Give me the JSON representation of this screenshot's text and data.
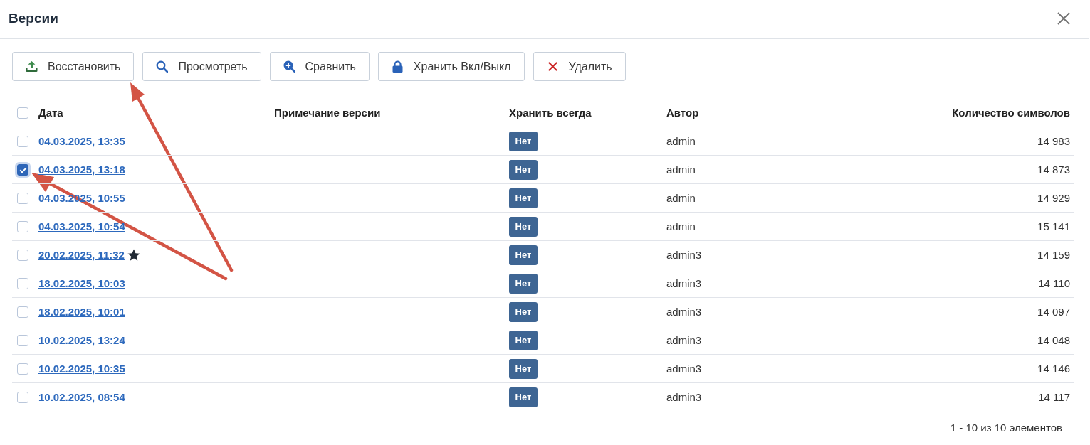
{
  "window": {
    "title": "Версии"
  },
  "toolbar": {
    "buttons": [
      {
        "label": "Восстановить",
        "kind": "restore"
      },
      {
        "label": "Просмотреть",
        "kind": "view"
      },
      {
        "label": "Сравнить",
        "kind": "compare"
      },
      {
        "label": "Хранить Вкл/Выкл",
        "kind": "keep"
      },
      {
        "label": "Удалить",
        "kind": "delete"
      }
    ]
  },
  "table": {
    "header_checkbox": {
      "checked": false
    },
    "columns": [
      {
        "label": "Дата"
      },
      {
        "label": "Примечание версии"
      },
      {
        "label": "Хранить всегда"
      },
      {
        "label": "Автор"
      },
      {
        "label": "Количество символов"
      }
    ],
    "rows": [
      {
        "checked": false,
        "date": "04.03.2025, 13:35",
        "starred": false,
        "keep_always": "Нет",
        "author": "admin",
        "characters": "14 983"
      },
      {
        "checked": true,
        "date": "04.03.2025, 13:18",
        "starred": false,
        "keep_always": "Нет",
        "author": "admin",
        "characters": "14 873"
      },
      {
        "checked": false,
        "date": "04.03.2025, 10:55",
        "starred": false,
        "keep_always": "Нет",
        "author": "admin",
        "characters": "14 929"
      },
      {
        "checked": false,
        "date": "04.03.2025, 10:54",
        "starred": false,
        "keep_always": "Нет",
        "author": "admin",
        "characters": "15 141"
      },
      {
        "checked": false,
        "date": "20.02.2025, 11:32",
        "starred": true,
        "keep_always": "Нет",
        "author": "admin3",
        "characters": "14 159"
      },
      {
        "checked": false,
        "date": "18.02.2025, 10:03",
        "starred": false,
        "keep_always": "Нет",
        "author": "admin3",
        "characters": "14 110"
      },
      {
        "checked": false,
        "date": "18.02.2025, 10:01",
        "starred": false,
        "keep_always": "Нет",
        "author": "admin3",
        "characters": "14 097"
      },
      {
        "checked": false,
        "date": "10.02.2025, 13:24",
        "starred": false,
        "keep_always": "Нет",
        "author": "admin3",
        "characters": "14 048"
      },
      {
        "checked": false,
        "date": "10.02.2025, 10:35",
        "starred": false,
        "keep_always": "Нет",
        "author": "admin3",
        "characters": "14 146"
      },
      {
        "checked": false,
        "date": "10.02.2025, 08:54",
        "starred": false,
        "keep_always": "Нет",
        "author": "admin3",
        "characters": "14 117"
      }
    ]
  },
  "pagination": {
    "summary": "1 - 10 из 10 элементов"
  }
}
